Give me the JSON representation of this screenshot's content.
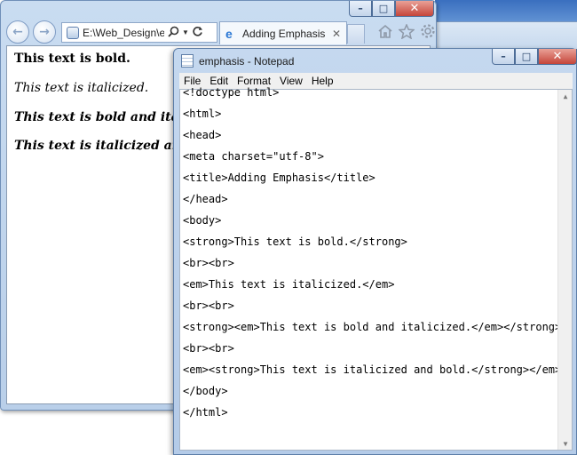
{
  "browser": {
    "address": "E:\\Web_Design\\en",
    "tab_title": "Adding Emphasis",
    "tab_close": "✕",
    "page_lines": [
      "This text is bold.",
      "This text is italicized.",
      "This text is bold and italicized.",
      "This text is italicized and bold."
    ]
  },
  "notepad": {
    "title": "emphasis - Notepad",
    "menu": [
      "File",
      "Edit",
      "Format",
      "View",
      "Help"
    ],
    "code_lines": [
      "<!doctype html>",
      "<html>",
      "<head>",
      "<meta charset=\"utf-8\">",
      "<title>Adding Emphasis</title>",
      "</head>",
      "<body>",
      "<strong>This text is bold.</strong>",
      "<br><br>",
      "<em>This text is italicized.</em>",
      "<br><br>",
      "<strong><em>This text is bold and italicized.</em></strong>",
      "<br><br>",
      "<em><strong>This text is italicized and bold.</strong></em>",
      "</body>",
      "</html>"
    ]
  },
  "caption_glyphs": {
    "minimize": "–",
    "maximize": "□",
    "close": "✕"
  },
  "icons": {
    "back": "back-arrow-icon",
    "forward": "forward-arrow-icon",
    "search": "search-icon",
    "refresh": "refresh-icon",
    "home": "home-icon",
    "favorites": "star-icon",
    "tools": "gear-icon"
  }
}
